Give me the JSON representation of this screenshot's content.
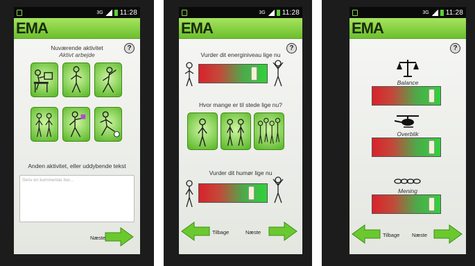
{
  "screens": [
    {
      "status": {
        "network": "3G",
        "time": "11:28"
      },
      "app_title": "EMA",
      "help_label": "?",
      "current_activity_label": "Nuværende aktivitet",
      "current_activity_value": "Aktivt arbejde",
      "other_activity_label": "Anden aktivitet, eller uddybende tekst",
      "comment_placeholder": "Skriv en kommentar her...",
      "next_label": "Næste"
    },
    {
      "status": {
        "network": "3G",
        "time": "11:28"
      },
      "app_title": "EMA",
      "help_label": "?",
      "energy_question": "Vurder dit energiniveau lige nu",
      "people_question": "Hvor mange er til stede lige nu?",
      "mood_question": "Vurder dit humør lige nu",
      "back_label": "Tilbage",
      "next_label": "Næste",
      "sliders": {
        "energy": 0.86,
        "mood": 0.82
      }
    },
    {
      "status": {
        "network": "3G",
        "time": "11:28"
      },
      "app_title": "EMA",
      "help_label": "?",
      "balance_label": "Balance",
      "overview_label": "Overblik",
      "meaning_label": "Mening",
      "back_label": "Tilbage",
      "next_label": "Næste",
      "sliders": {
        "balance": 0.93,
        "overview": 0.93,
        "meaning": 0.93
      }
    }
  ]
}
